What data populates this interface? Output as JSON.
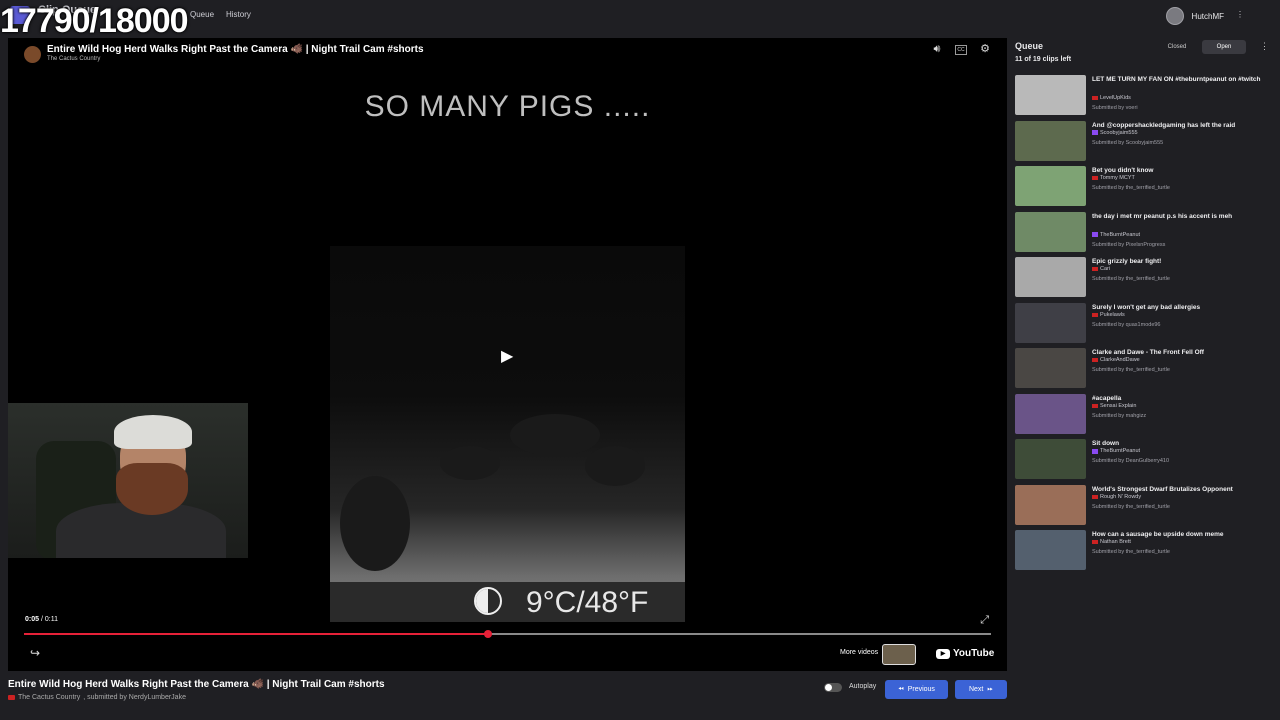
{
  "overlay": {
    "counter": "17790/18000"
  },
  "app": {
    "title": "Clip Queue",
    "nav_queue": "Queue",
    "nav_history": "History"
  },
  "user": {
    "name": "HutchMF",
    "menu": "⋮"
  },
  "player": {
    "title": "Entire Wild Hog Herd Walks Right Past the Camera 🐗 | Night Trail Cam #shorts",
    "channel": "The Cactus Country",
    "caption": "SO MANY PIGS .....",
    "temperature": "9°C/48°F",
    "time_current": "0:05",
    "time_total": "0:11",
    "progress": 0.48,
    "more_videos": "More videos",
    "youtube": "YouTube"
  },
  "below": {
    "title": "Entire Wild Hog Herd Walks Right Past the Camera 🐗 | Night Trail Cam #shorts",
    "channel": "The Cactus Country",
    "submitted_by": ", submitted by NerdyLumberJake"
  },
  "controls": {
    "autoplay": "Autoplay",
    "previous": "Previous",
    "next": "Next"
  },
  "queue": {
    "heading": "Queue",
    "count": "11 of 19 clips left",
    "closed": "Closed",
    "open": "Open",
    "items": [
      {
        "title": "LET ME TURN MY FAN ON #theburntpeanut on #twitch",
        "channel": "LevelUpKids",
        "submitted": "Submitted by voeri",
        "platform": "youtube",
        "thumb": "#b9b9b9"
      },
      {
        "title": "And @coppershackledgaming has left the raid",
        "channel": "Scoobyjaim555",
        "submitted": "Submitted by Scoobyjaim555",
        "platform": "twitch",
        "thumb": "#5d6a4e"
      },
      {
        "title": "Bet you didn't know",
        "channel": "Tommy MCYT",
        "submitted": "Submitted by the_terrified_turtle",
        "platform": "youtube",
        "thumb": "#7ea374"
      },
      {
        "title": "the day i met mr peanut p.s his accent is meh",
        "channel": "TheBurntPeanut",
        "submitted": "Submitted by PixelsnProgress",
        "platform": "twitch",
        "thumb": "#6f8a66"
      },
      {
        "title": "Epic grizzly bear fight!",
        "channel": "Cari",
        "submitted": "Submitted by the_terrified_turtle",
        "platform": "youtube",
        "thumb": "#a9a9a9"
      },
      {
        "title": "Surely I won't get any bad allergies",
        "channel": "Pukelawls",
        "submitted": "Submitted by quas1mode96",
        "platform": "youtube",
        "thumb": "#3f3f46"
      },
      {
        "title": "Clarke and Dawe - The Front Fell Off",
        "channel": "ClarkeAndDawe",
        "submitted": "Submitted by the_terrified_turtle",
        "platform": "youtube",
        "thumb": "#4a4744"
      },
      {
        "title": "#acapella",
        "channel": "Sensai Explain",
        "submitted": "Submitted by mahgizz",
        "platform": "youtube",
        "thumb": "#6a5488"
      },
      {
        "title": "Sit down",
        "channel": "TheBurntPeanut",
        "submitted": "Submitted by DeanGulberry410",
        "platform": "twitch",
        "thumb": "#3e4c38"
      },
      {
        "title": "World's Strongest Dwarf Brutalizes Opponent",
        "channel": "Rough N' Rowdy",
        "submitted": "Submitted by the_terrified_turtle",
        "platform": "youtube",
        "thumb": "#9a6e58"
      },
      {
        "title": "How can a sausage be upside down meme",
        "channel": "Nathan Brett",
        "submitted": "Submitted by the_terrified_turtle",
        "platform": "youtube",
        "thumb": "#54606e"
      }
    ]
  }
}
